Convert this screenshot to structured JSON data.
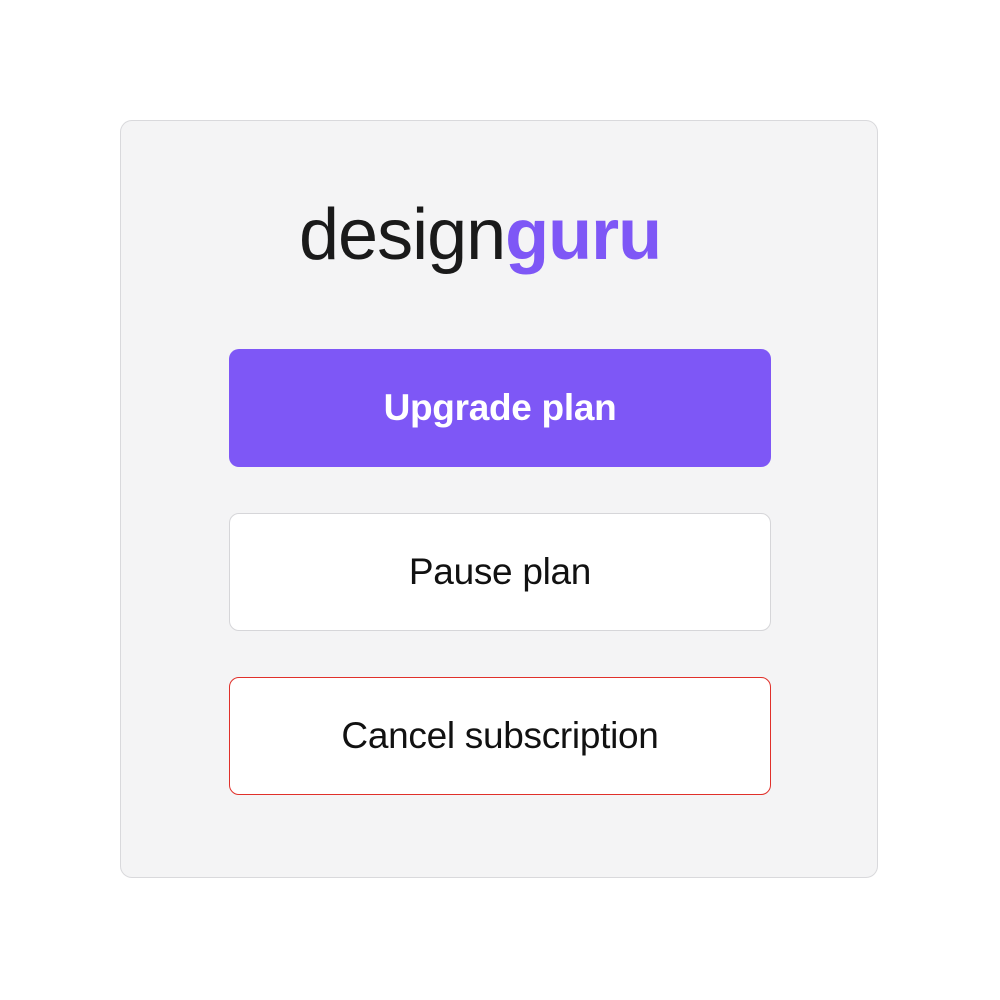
{
  "logo": {
    "part_dark": "design",
    "part_accent": "guru",
    "dark_color": "#1a1a1a",
    "accent_color": "#7e57f6"
  },
  "actions": {
    "upgrade_label": "Upgrade plan",
    "pause_label": "Pause plan",
    "cancel_label": "Cancel subscription"
  },
  "colors": {
    "primary": "#7e57f6",
    "danger_border": "#e0302a",
    "card_background": "#f4f4f5"
  }
}
